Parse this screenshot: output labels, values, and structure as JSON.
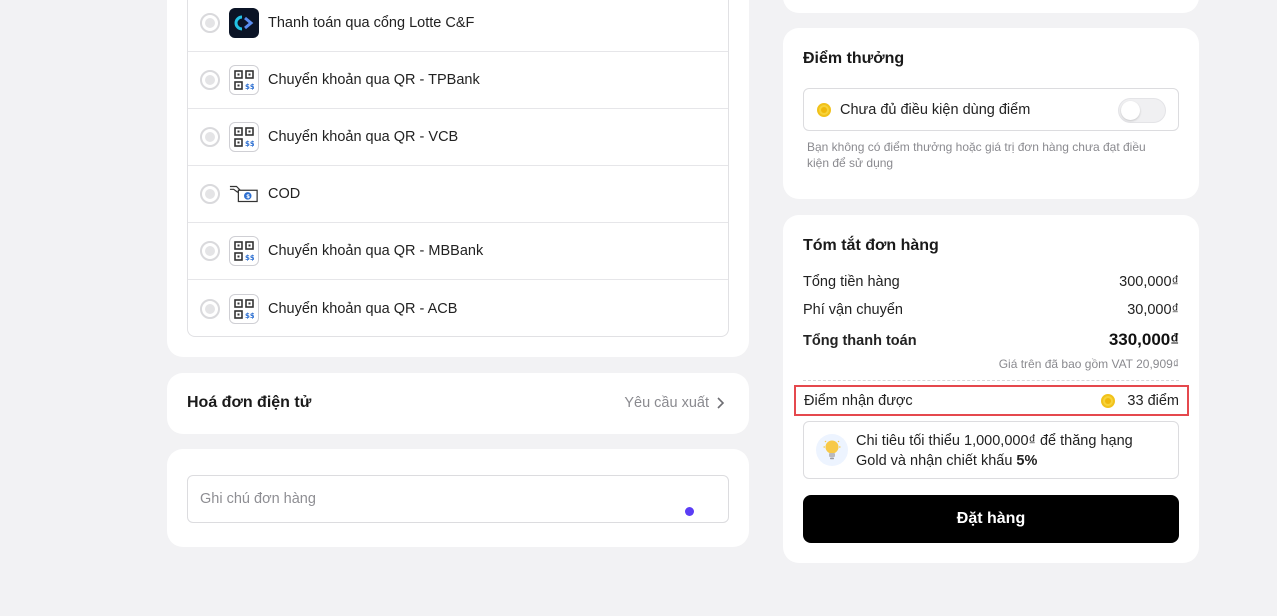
{
  "payment_methods": [
    {
      "label": "Thanh toán qua cổng Lotte C&F",
      "icon": "lotte-logo-icon"
    },
    {
      "label": "Chuyển khoản qua QR - TPBank",
      "icon": "qr-code-icon"
    },
    {
      "label": "Chuyển khoản qua QR - VCB",
      "icon": "qr-code-icon"
    },
    {
      "label": "COD",
      "icon": "cash-hand-icon"
    },
    {
      "label": "Chuyển khoản qua QR - MBBank",
      "icon": "qr-code-icon"
    },
    {
      "label": "Chuyển khoản qua QR - ACB",
      "icon": "qr-code-icon"
    }
  ],
  "invoice": {
    "title": "Hoá đơn điện tử",
    "action": "Yêu cầu xuất"
  },
  "note": {
    "placeholder": "Ghi chú đơn hàng"
  },
  "points": {
    "title": "Điểm thưởng",
    "status": "Chưa đủ điều kiện dùng điểm",
    "toggle_on": false,
    "hint": "Bạn không có điểm thưởng hoặc giá trị đơn hàng chưa đạt điều kiện để sử dụng"
  },
  "summary": {
    "title": "Tóm tắt đơn hàng",
    "subtotal_label": "Tổng tiền hàng",
    "subtotal_value": "300,000₫",
    "shipping_label": "Phí vận chuyển",
    "shipping_value": "30,000₫",
    "total_label": "Tổng thanh toán",
    "total_value": "330,000₫",
    "vat_note": "Giá trên đã bao gồm VAT 20,909₫",
    "earned_label": "Điểm nhận được",
    "earned_value": "33 điểm",
    "tip_prefix": "Chi tiêu tối thiểu 1,000,000₫ để thăng hạng Gold và nhận chiết khấu ",
    "tip_bold": "5%",
    "order_button": "Đặt hàng"
  },
  "colors": {
    "accent_dot": "#5b3df5",
    "highlight_border": "#e5484d",
    "coin": "#f0b90b",
    "button_bg": "#000000"
  }
}
